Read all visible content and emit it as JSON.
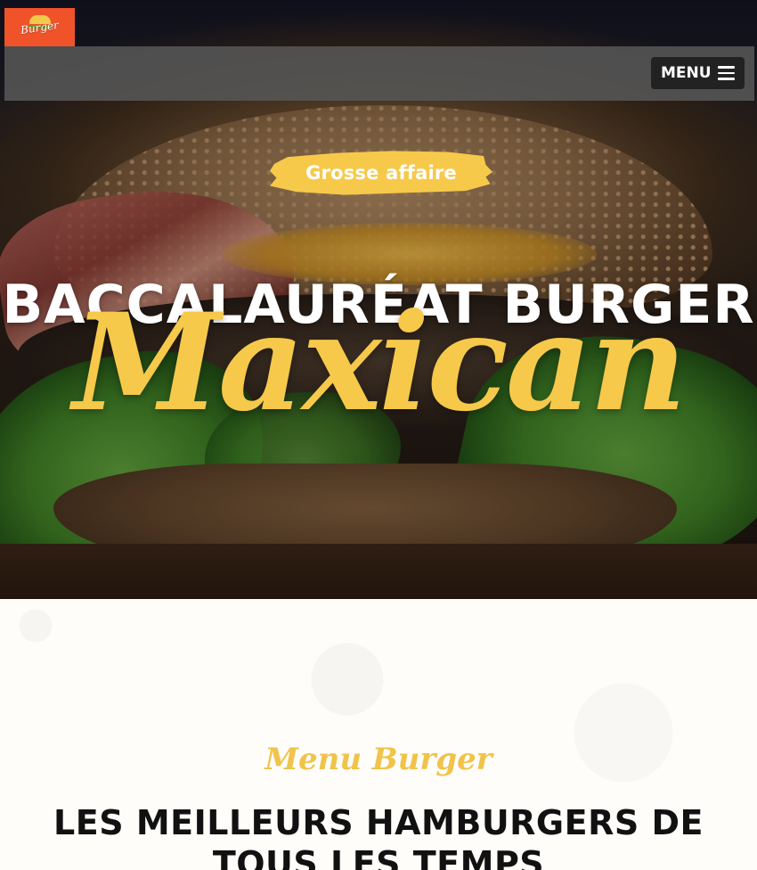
{
  "header": {
    "logo_text": "Burger",
    "menu_label": "MENU"
  },
  "hero": {
    "badge": "Grosse affaire",
    "headline": "BACCALAURÉAT BURGER",
    "script_title": "Maxican"
  },
  "menu_section": {
    "subtitle": "Menu Burger",
    "title": "LES MEILLEURS HAMBURGERS DE TOUS LES TEMPS"
  },
  "colors": {
    "accent_yellow": "#f6c94b",
    "logo_orange": "#f0522a",
    "nav_bar": "#565656",
    "menu_button": "#222222"
  },
  "icons": {
    "menu": "hamburger-menu-icon",
    "logo": "burger-logo-icon"
  }
}
